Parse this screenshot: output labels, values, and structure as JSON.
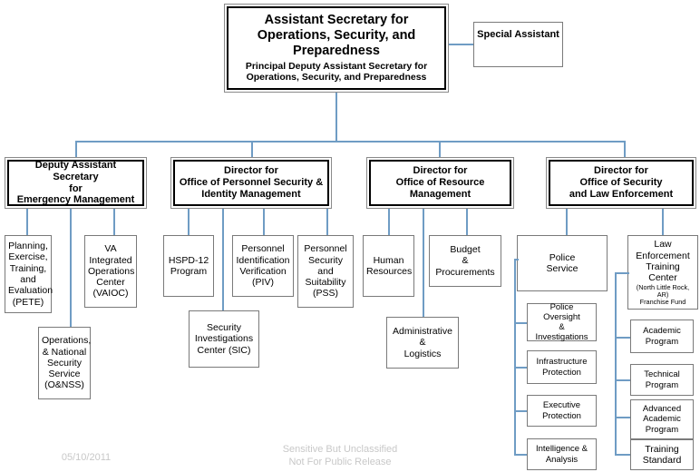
{
  "document": {
    "kind": "organization-chart",
    "accent_connector_color": "#6f9cc4",
    "box_border_color": "#7a7a7a"
  },
  "nodes": {
    "assistant_secretary": {
      "title": "Assistant Secretary for\nOperations, Security, and\nPreparedness",
      "subtitle": "Principal Deputy Assistant Secretary for\nOperations, Security, and Preparedness"
    },
    "special_assistant": {
      "label": "Special Assistant"
    },
    "directorates": [
      {
        "label": "Deputy Assistant Secretary\nfor\nEmergency Management"
      },
      {
        "label": "Director for\nOffice of Personnel Security &\nIdentity Management"
      },
      {
        "label": "Director for\nOffice of Resource\nManagement"
      },
      {
        "label": "Director for\nOffice of Security\nand Law Enforcement"
      }
    ],
    "emergency_management_children": [
      {
        "label": "Planning,\nExercise,\nTraining,\nand\nEvaluation\n(PETE)"
      },
      {
        "label": "Operations,\n& National\nSecurity\nService\n(O&NSS)"
      },
      {
        "label": "VA\nIntegrated\nOperations\nCenter\n(VAIOC)"
      }
    ],
    "personnel_security_children": [
      {
        "label": "HSPD-12\nProgram"
      },
      {
        "label": "Security\nInvestigations\nCenter (SIC)"
      },
      {
        "label": "Personnel\nIdentification\nVerification\n(PIV)"
      },
      {
        "label": "Personnel\nSecurity\nand\nSuitability\n(PSS)"
      }
    ],
    "resource_management_children": [
      {
        "label": "Human\nResources"
      },
      {
        "label": "Administrative\n&\nLogistics"
      },
      {
        "label": "Budget\n&\nProcurements"
      }
    ],
    "security_law_enforcement_children": [
      {
        "label": "Police\nService",
        "sub_units": [
          {
            "label": "Police Oversight\n&\nInvestigations"
          },
          {
            "label": "Infrastructure\nProtection"
          },
          {
            "label": "Executive\nProtection"
          },
          {
            "label": "Intelligence &\nAnalysis"
          }
        ]
      },
      {
        "label": "Law\nEnforcement\nTraining\nCenter",
        "detail": "(North Little Rock,\nAR)\nFranchise Fund",
        "sub_units": [
          {
            "label": "Academic\nProgram"
          },
          {
            "label": "Technical\nProgram"
          },
          {
            "label": "Advanced\nAcademic\nProgram"
          },
          {
            "label": "Training\nStandard"
          }
        ]
      }
    ]
  },
  "footer": {
    "date": "05/10/2011",
    "classification": "Sensitive But Unclassified\nNot For Public Release"
  }
}
